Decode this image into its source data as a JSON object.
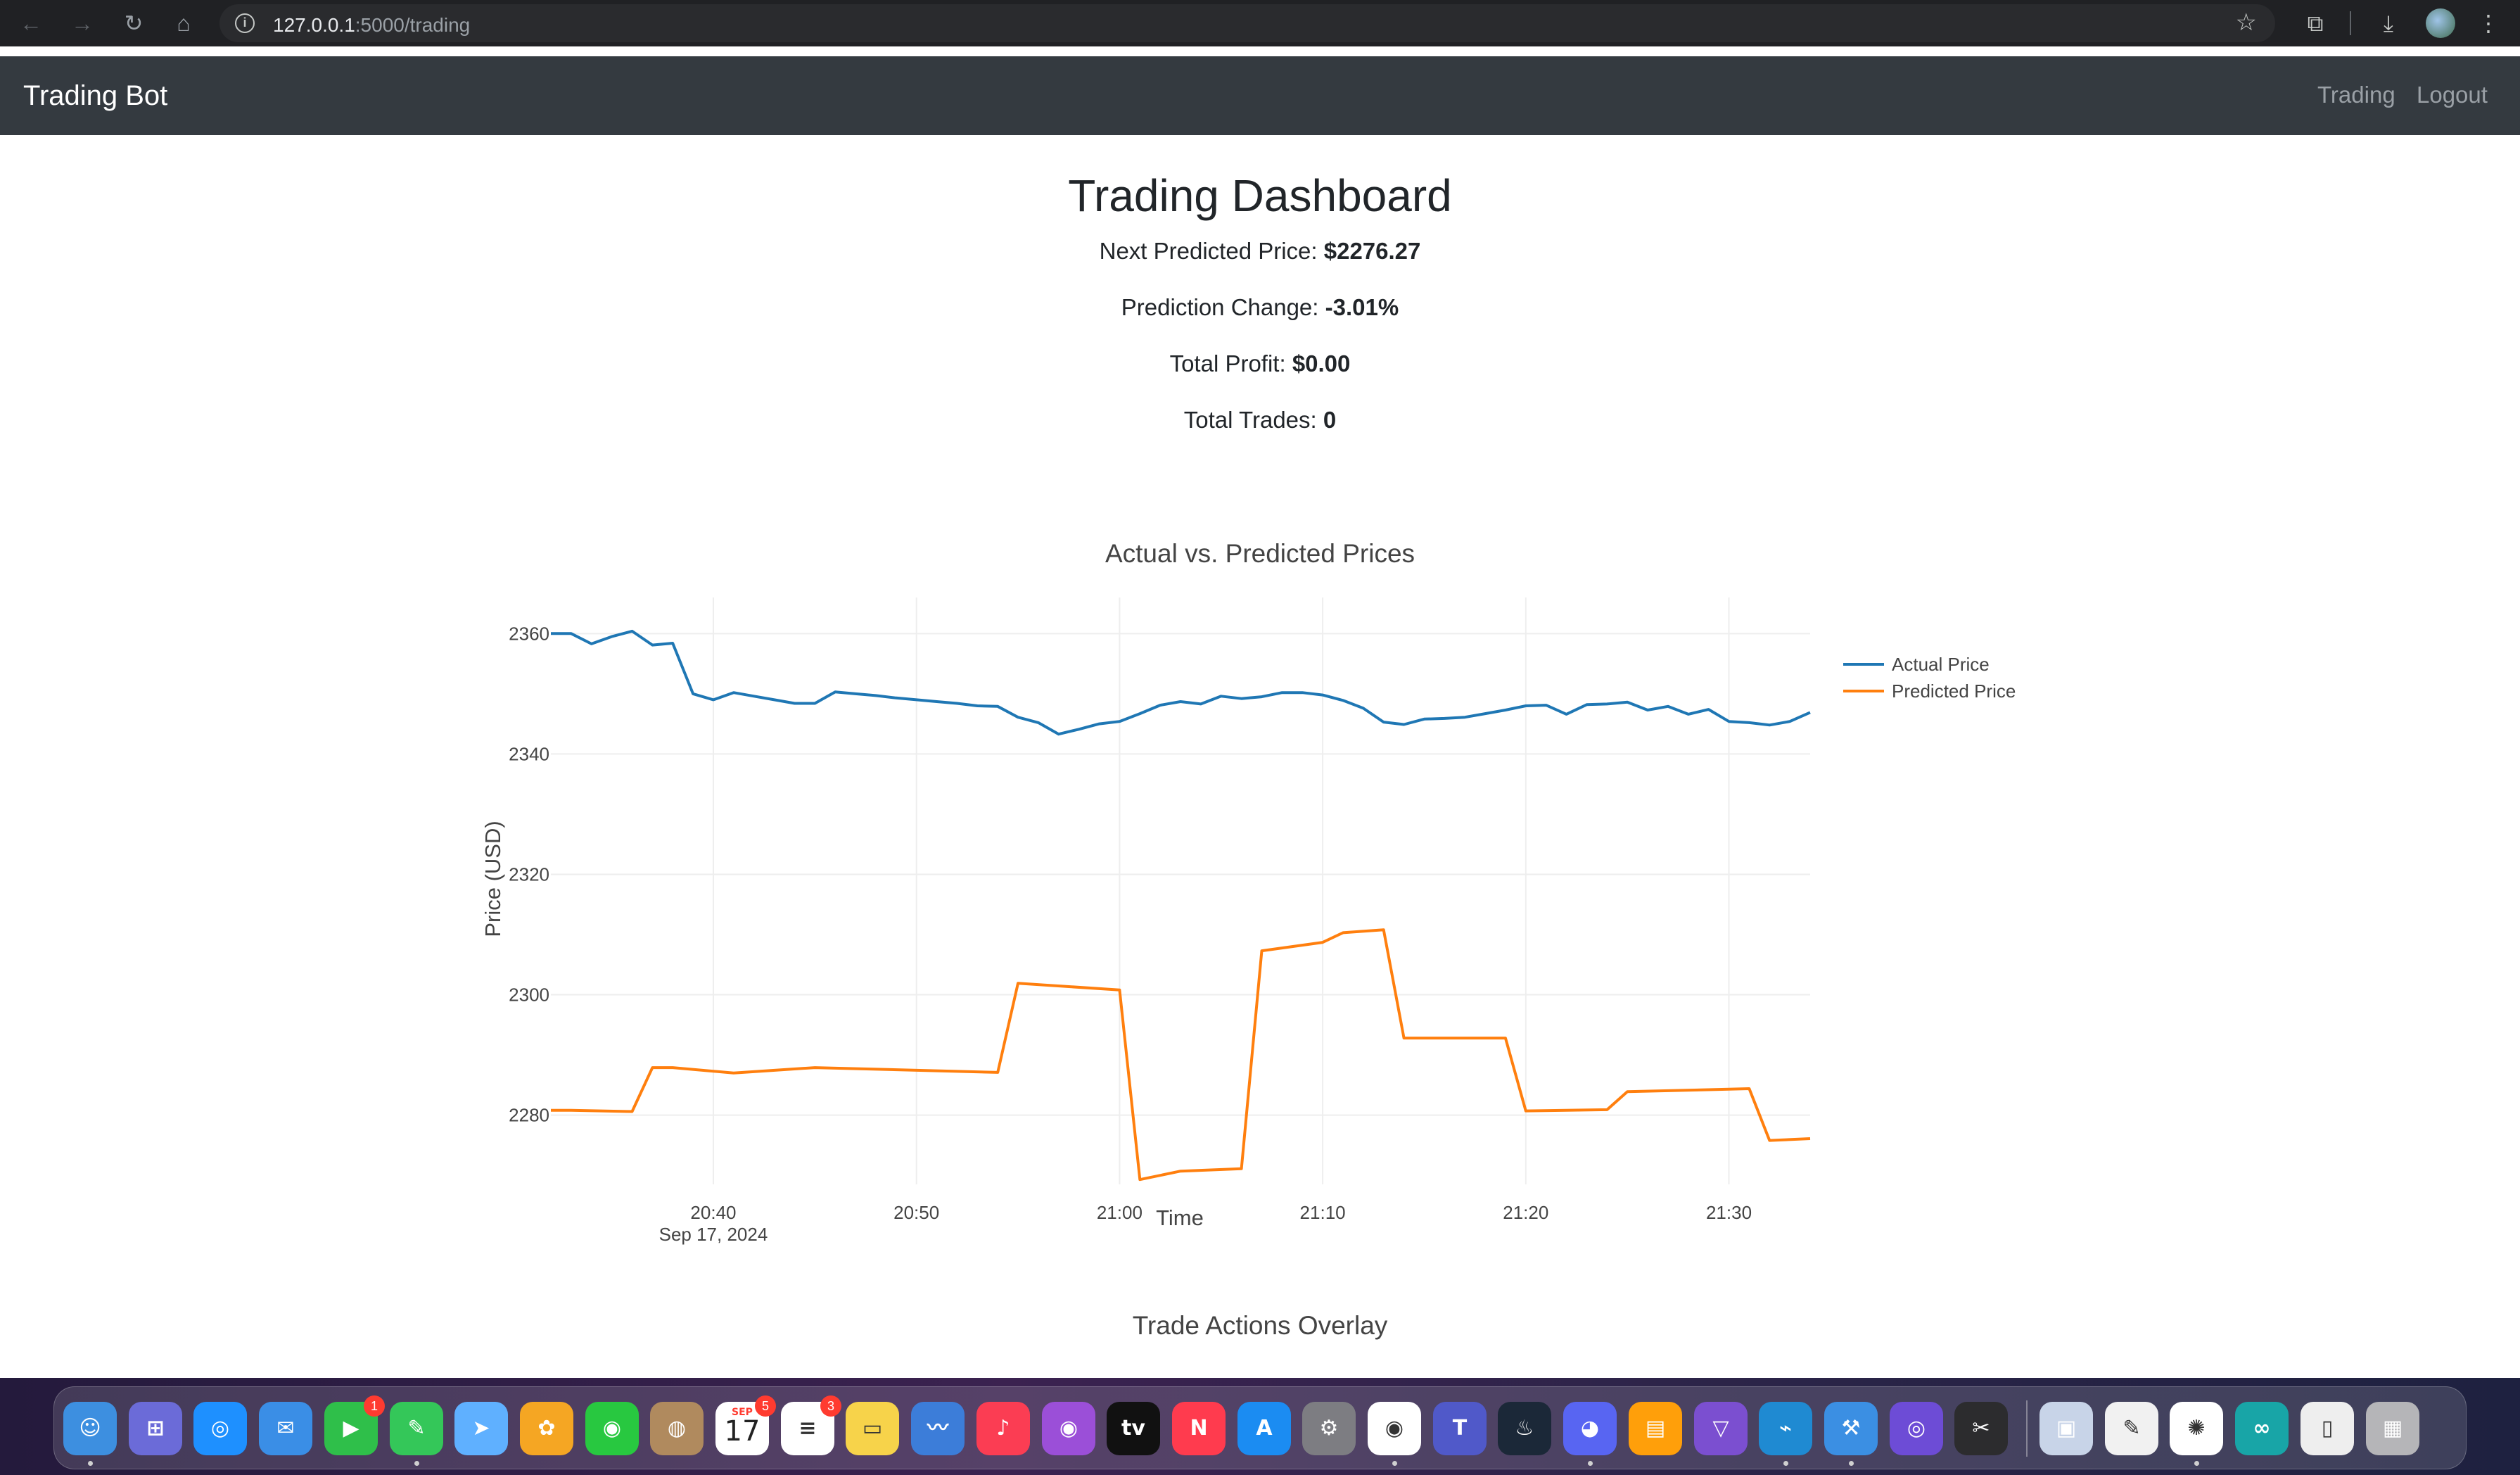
{
  "browser": {
    "url_host": "127.0.0.1",
    "url_path": ":5000/trading",
    "icons": [
      "back-icon",
      "forward-icon",
      "reload-icon",
      "home-icon",
      "site-info-icon",
      "bookmark-star-icon",
      "extensions-icon",
      "downloads-icon",
      "profile-avatar",
      "menu-kebab-icon"
    ]
  },
  "navbar": {
    "brand": "Trading Bot",
    "links": [
      "Trading",
      "Logout"
    ]
  },
  "dashboard": {
    "title": "Trading Dashboard",
    "stats": [
      {
        "label": "Next Predicted Price: ",
        "value": "$2276.27"
      },
      {
        "label": "Prediction Change: ",
        "value": "-3.01%"
      },
      {
        "label": "Total Profit: ",
        "value": "$0.00"
      },
      {
        "label": "Total Trades: ",
        "value": "0"
      }
    ]
  },
  "chart_data": {
    "type": "line",
    "title": "Actual vs. Predicted Prices",
    "xlabel": "Time",
    "ylabel": "Price (USD)",
    "x_start": "2024-09-17 20:32",
    "x_end": "2024-09-17 21:34",
    "xlim": [
      "2024-09-17 20:32",
      "2024-09-17 21:34"
    ],
    "ylim": [
      2268.5,
      2366
    ],
    "y_ticks": [
      2280,
      2300,
      2320,
      2340,
      2360
    ],
    "x_ticks": [
      "20:40",
      "20:50",
      "21:00",
      "21:10",
      "21:20",
      "21:30"
    ],
    "x_date_label": "Sep 17, 2024",
    "grid": true,
    "legend_position": "top-right",
    "series": [
      {
        "name": "Actual Price",
        "color": "#1f77b4",
        "points": [
          [
            "20:32",
            2360.0
          ],
          [
            "20:33",
            2360.0
          ],
          [
            "20:34",
            2358.3
          ],
          [
            "20:35",
            2359.5
          ],
          [
            "20:36",
            2360.4
          ],
          [
            "20:37",
            2358.1
          ],
          [
            "20:38",
            2358.4
          ],
          [
            "20:39",
            2350.0
          ],
          [
            "20:40",
            2349.0
          ],
          [
            "20:41",
            2350.2
          ],
          [
            "20:42",
            2349.6
          ],
          [
            "20:43",
            2349.0
          ],
          [
            "20:44",
            2348.4
          ],
          [
            "20:45",
            2348.4
          ],
          [
            "20:46",
            2350.3
          ],
          [
            "20:47",
            2350.0
          ],
          [
            "20:48",
            2349.7
          ],
          [
            "20:49",
            2349.3
          ],
          [
            "20:50",
            2349.0
          ],
          [
            "20:51",
            2348.7
          ],
          [
            "20:52",
            2348.4
          ],
          [
            "20:53",
            2348.0
          ],
          [
            "20:54",
            2347.9
          ],
          [
            "20:55",
            2346.1
          ],
          [
            "20:56",
            2345.2
          ],
          [
            "20:57",
            2343.3
          ],
          [
            "20:58",
            2344.1
          ],
          [
            "20:59",
            2345.0
          ],
          [
            "21:00",
            2345.4
          ],
          [
            "21:01",
            2346.7
          ],
          [
            "21:02",
            2348.1
          ],
          [
            "21:03",
            2348.7
          ],
          [
            "21:04",
            2348.3
          ],
          [
            "21:05",
            2349.6
          ],
          [
            "21:06",
            2349.2
          ],
          [
            "21:07",
            2349.5
          ],
          [
            "21:08",
            2350.2
          ],
          [
            "21:09",
            2350.2
          ],
          [
            "21:10",
            2349.8
          ],
          [
            "21:11",
            2348.9
          ],
          [
            "21:12",
            2347.6
          ],
          [
            "21:13",
            2345.3
          ],
          [
            "21:14",
            2344.9
          ],
          [
            "21:15",
            2345.8
          ],
          [
            "21:16",
            2345.9
          ],
          [
            "21:17",
            2346.1
          ],
          [
            "21:18",
            2346.7
          ],
          [
            "21:19",
            2347.3
          ],
          [
            "21:20",
            2348.0
          ],
          [
            "21:21",
            2348.1
          ],
          [
            "21:22",
            2346.6
          ],
          [
            "21:23",
            2348.2
          ],
          [
            "21:24",
            2348.3
          ],
          [
            "21:25",
            2348.6
          ],
          [
            "21:26",
            2347.3
          ],
          [
            "21:27",
            2347.9
          ],
          [
            "21:28",
            2346.6
          ],
          [
            "21:29",
            2347.4
          ],
          [
            "21:30",
            2345.4
          ],
          [
            "21:31",
            2345.2
          ],
          [
            "21:32",
            2344.8
          ],
          [
            "21:33",
            2345.4
          ],
          [
            "21:34",
            2346.9
          ]
        ]
      },
      {
        "name": "Predicted Price",
        "color": "#ff7f0e",
        "points": [
          [
            "20:32",
            2280.8
          ],
          [
            "20:33",
            2280.8
          ],
          [
            "20:36",
            2280.6
          ],
          [
            "20:37",
            2287.9
          ],
          [
            "20:38",
            2287.9
          ],
          [
            "20:41",
            2287.0
          ],
          [
            "20:45",
            2287.9
          ],
          [
            "20:54",
            2287.1
          ],
          [
            "20:55",
            2301.9
          ],
          [
            "21:00",
            2300.8
          ],
          [
            "21:01",
            2269.3
          ],
          [
            "21:03",
            2270.7
          ],
          [
            "21:06",
            2271.1
          ],
          [
            "21:07",
            2307.3
          ],
          [
            "21:10",
            2308.7
          ],
          [
            "21:11",
            2310.3
          ],
          [
            "21:13",
            2310.8
          ],
          [
            "21:14",
            2292.8
          ],
          [
            "21:19",
            2292.8
          ],
          [
            "21:20",
            2280.7
          ],
          [
            "21:24",
            2280.9
          ],
          [
            "21:25",
            2283.9
          ],
          [
            "21:30",
            2284.3
          ],
          [
            "21:31",
            2284.4
          ],
          [
            "21:32",
            2275.8
          ],
          [
            "21:34",
            2276.1
          ]
        ]
      }
    ]
  },
  "overlay": {
    "title": "Trade Actions Overlay"
  },
  "dock": {
    "apps": [
      "Finder",
      "Launchpad",
      "Safari",
      "Mail",
      "FaceTime",
      "Messages",
      "Maps",
      "Photos",
      "Find My",
      "Contacts",
      "Calendar",
      "Reminders",
      "Notes",
      "Freeform",
      "Music",
      "Podcasts",
      "TV",
      "News",
      "App Store",
      "System Settings",
      "Chrome",
      "Teams",
      "Steam",
      "Discord",
      "Books",
      "Visual Studio",
      "VS Code",
      "Xcode",
      "Siri",
      "Final Cut Pro",
      "Preview",
      "TextEdit",
      "Pinwheel",
      "Arduino",
      "Archive",
      "Trash"
    ],
    "badges": [
      {
        "app": "FaceTime",
        "count": "1"
      },
      {
        "app": "Calendar",
        "count": "5"
      },
      {
        "app": "Reminders",
        "count": "3"
      }
    ],
    "calendar_month": "SEP",
    "calendar_day": "17"
  }
}
